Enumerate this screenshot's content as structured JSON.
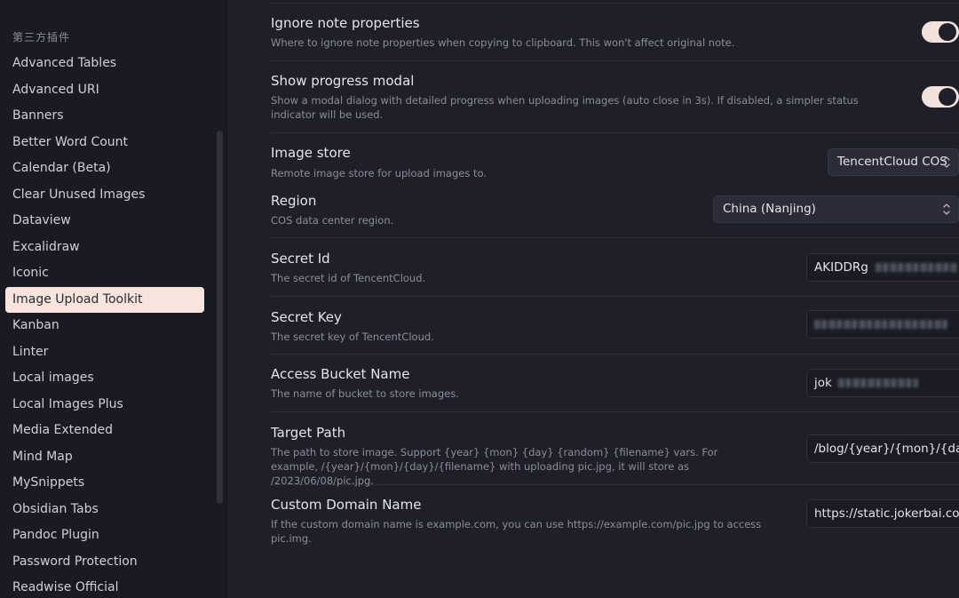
{
  "sidebar": {
    "heading": "第三方插件",
    "items": [
      {
        "label": "Advanced Tables"
      },
      {
        "label": "Advanced URI"
      },
      {
        "label": "Banners"
      },
      {
        "label": "Better Word Count"
      },
      {
        "label": "Calendar (Beta)"
      },
      {
        "label": "Clear Unused Images"
      },
      {
        "label": "Dataview"
      },
      {
        "label": "Excalidraw"
      },
      {
        "label": "Iconic"
      },
      {
        "label": "Image Upload Toolkit",
        "active": true
      },
      {
        "label": "Kanban"
      },
      {
        "label": "Linter"
      },
      {
        "label": "Local images"
      },
      {
        "label": "Local Images Plus"
      },
      {
        "label": "Media Extended"
      },
      {
        "label": "Mind Map"
      },
      {
        "label": "MySnippets"
      },
      {
        "label": "Obsidian Tabs"
      },
      {
        "label": "Pandoc Plugin"
      },
      {
        "label": "Password Protection"
      },
      {
        "label": "Readwise Official"
      }
    ]
  },
  "settings": {
    "ignore_props": {
      "title": "Ignore note properties",
      "desc": "Where to ignore note properties when copying to clipboard. This won't affect original note.",
      "enabled": true
    },
    "progress_modal": {
      "title": "Show progress modal",
      "desc": "Show a modal dialog with detailed progress when uploading images (auto close in 3s). If disabled, a simpler status indicator will be used.",
      "enabled": true
    },
    "image_store": {
      "title": "Image store",
      "desc": "Remote image store for upload images to.",
      "value": "TencentCloud COS"
    },
    "region": {
      "title": "Region",
      "desc": "COS data center region.",
      "value": "China (Nanjing)"
    },
    "secret_id": {
      "title": "Secret Id",
      "desc": "The secret id of TencentCloud.",
      "value_visible": "AKIDDRg"
    },
    "secret_key": {
      "title": "Secret Key",
      "desc": "The secret key of TencentCloud.",
      "value_visible": ""
    },
    "bucket": {
      "title": "Access Bucket Name",
      "desc": "The name of bucket to store images.",
      "value_visible": "jok"
    },
    "target_path": {
      "title": "Target Path",
      "desc": "The path to store image. Support {year} {mon} {day} {random} {filename} vars. For example, /{year}/{mon}/{day}/{filename} with uploading pic.jpg, it will store as /2023/06/08/pic.jpg.",
      "value": "/blog/{year}/{mon}/{day}/{"
    },
    "custom_domain": {
      "title": "Custom Domain Name",
      "desc": "If the custom domain name is example.com, you can use https://example.com/pic.jpg to access pic.img.",
      "value": "https://static.jokerbai.com"
    }
  },
  "icons": {
    "select_chevron": "chevrons-up-down-icon",
    "toggle_knob": "toggle-knob"
  },
  "colors": {
    "accent": "#f3e2dc",
    "background": "#1e1f29",
    "sidebar": "#1a1b22"
  }
}
